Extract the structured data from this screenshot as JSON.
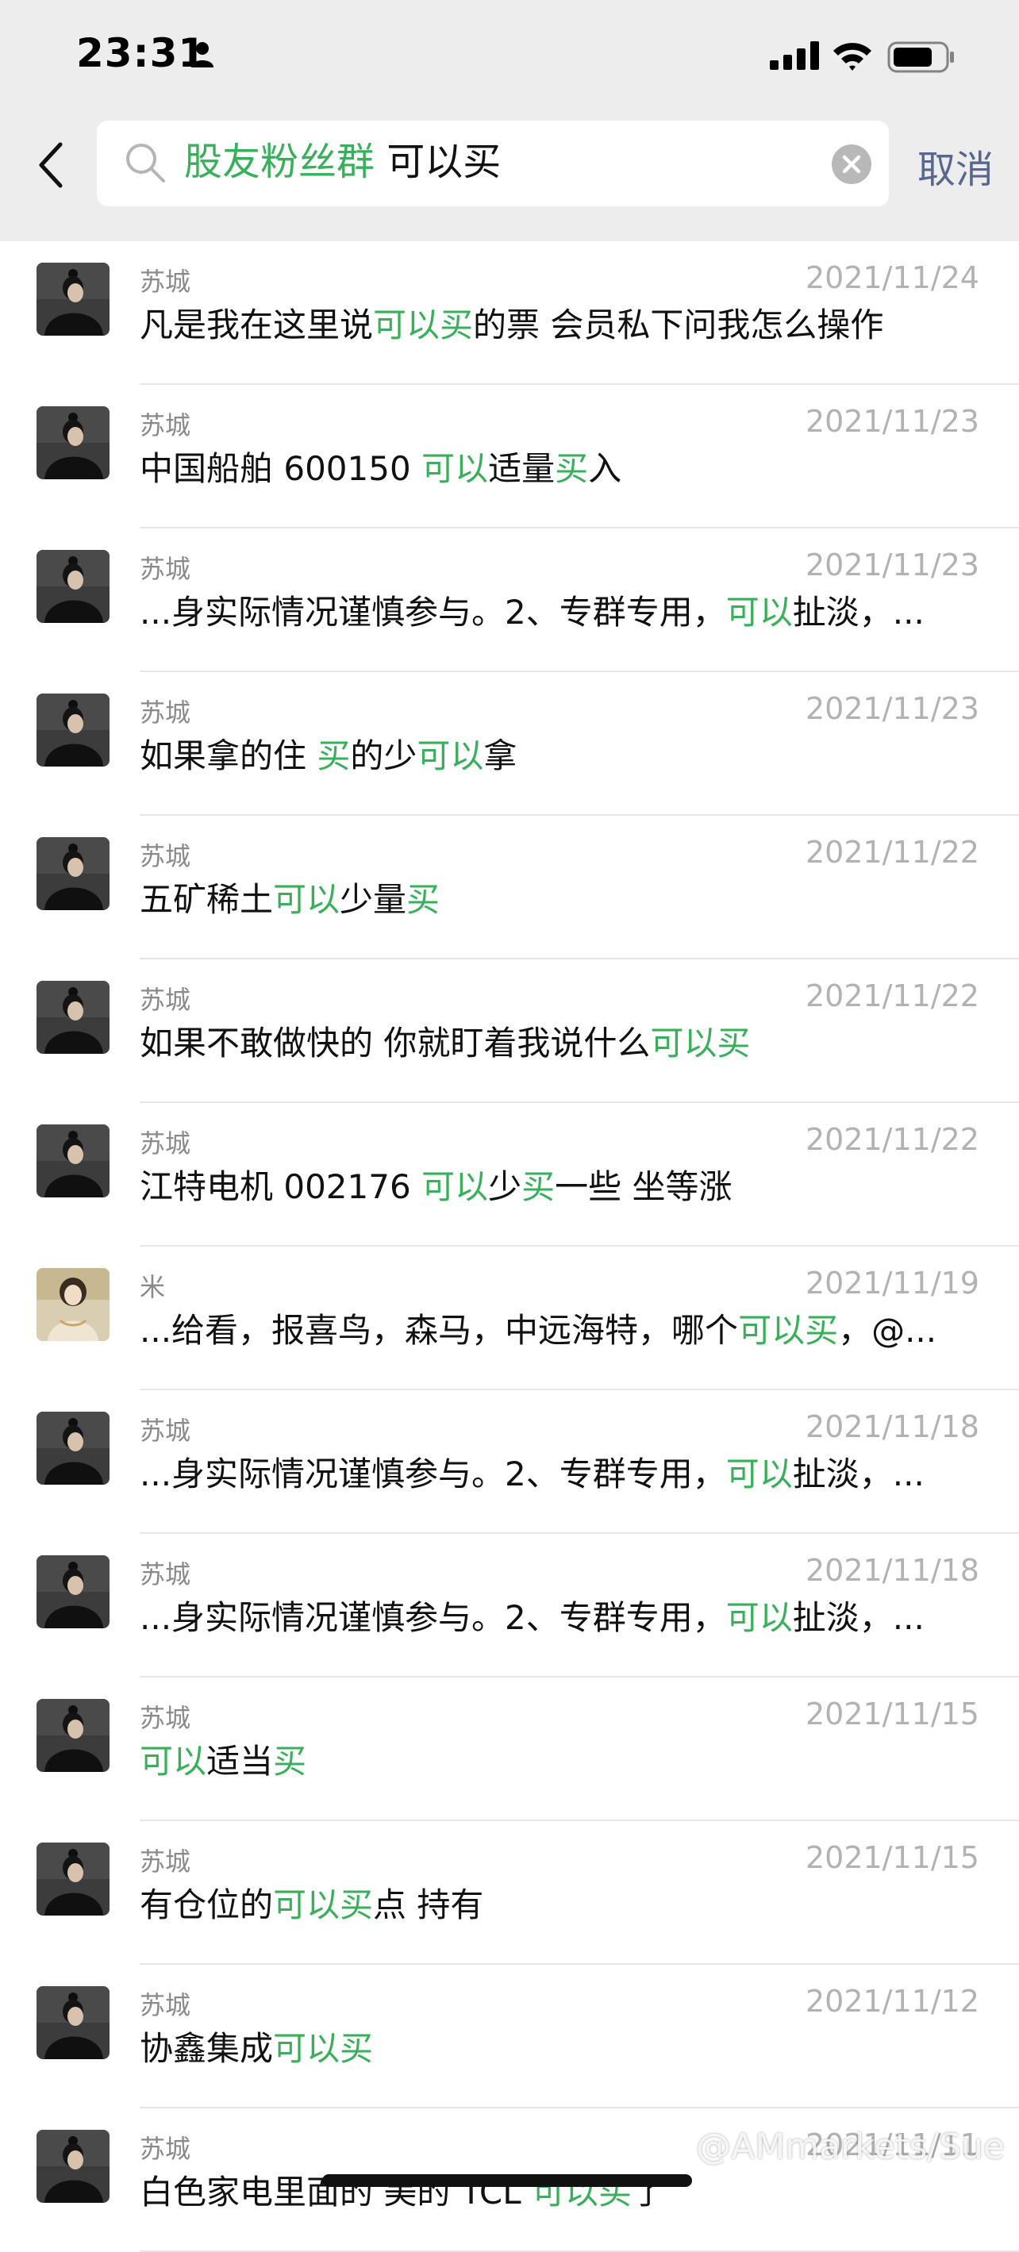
{
  "status_bar": {
    "time": "23:31"
  },
  "search": {
    "chat_tag": "股友粉丝群",
    "query": "可以买",
    "cancel_label": "取消"
  },
  "results": [
    {
      "name": "苏城",
      "date": "2021/11/24",
      "avatar": "man",
      "parts": [
        [
          "凡是我在这里说",
          false
        ],
        [
          "可以买",
          true
        ],
        [
          "的票  会员私下问我怎么操作",
          false
        ]
      ]
    },
    {
      "name": "苏城",
      "date": "2021/11/23",
      "avatar": "man",
      "parts": [
        [
          "中国船舶 600150 ",
          false
        ],
        [
          "可以",
          true
        ],
        [
          "适量",
          false
        ],
        [
          "买",
          true
        ],
        [
          "入",
          false
        ]
      ]
    },
    {
      "name": "苏城",
      "date": "2021/11/23",
      "avatar": "man",
      "parts": [
        [
          "...身实际情况谨慎参与。2、专群专用，",
          false
        ],
        [
          "可以",
          true
        ],
        [
          "扯淡，...",
          false
        ]
      ]
    },
    {
      "name": "苏城",
      "date": "2021/11/23",
      "avatar": "man",
      "parts": [
        [
          "如果拿的住 ",
          false
        ],
        [
          "买",
          true
        ],
        [
          "的少",
          false
        ],
        [
          "可以",
          true
        ],
        [
          "拿",
          false
        ]
      ]
    },
    {
      "name": "苏城",
      "date": "2021/11/22",
      "avatar": "man",
      "parts": [
        [
          "五矿稀土",
          false
        ],
        [
          "可以",
          true
        ],
        [
          "少量",
          false
        ],
        [
          "买",
          true
        ]
      ]
    },
    {
      "name": "苏城",
      "date": "2021/11/22",
      "avatar": "man",
      "parts": [
        [
          "如果不敢做快的 你就盯着我说什么",
          false
        ],
        [
          "可以买",
          true
        ]
      ]
    },
    {
      "name": "苏城",
      "date": "2021/11/22",
      "avatar": "man",
      "parts": [
        [
          "江特电机 002176  ",
          false
        ],
        [
          "可以",
          true
        ],
        [
          "少",
          false
        ],
        [
          "买",
          true
        ],
        [
          "一些 坐等涨",
          false
        ]
      ]
    },
    {
      "name": "米",
      "date": "2021/11/19",
      "avatar": "woman",
      "parts": [
        [
          "...给看，报喜鸟，森马，中远海特，哪个",
          false
        ],
        [
          "可以买",
          true
        ],
        [
          "，@...",
          false
        ]
      ]
    },
    {
      "name": "苏城",
      "date": "2021/11/18",
      "avatar": "man",
      "parts": [
        [
          "...身实际情况谨慎参与。2、专群专用，",
          false
        ],
        [
          "可以",
          true
        ],
        [
          "扯淡，...",
          false
        ]
      ]
    },
    {
      "name": "苏城",
      "date": "2021/11/18",
      "avatar": "man",
      "parts": [
        [
          "...身实际情况谨慎参与。2、专群专用，",
          false
        ],
        [
          "可以",
          true
        ],
        [
          "扯淡，...",
          false
        ]
      ]
    },
    {
      "name": "苏城",
      "date": "2021/11/15",
      "avatar": "man",
      "parts": [
        [
          "可以",
          true
        ],
        [
          "适当",
          false
        ],
        [
          "买",
          true
        ]
      ]
    },
    {
      "name": "苏城",
      "date": "2021/11/15",
      "avatar": "man",
      "parts": [
        [
          "有仓位的",
          false
        ],
        [
          "可以买",
          true
        ],
        [
          "点  持有",
          false
        ]
      ]
    },
    {
      "name": "苏城",
      "date": "2021/11/12",
      "avatar": "man",
      "parts": [
        [
          "协鑫集成",
          false
        ],
        [
          "可以买",
          true
        ]
      ]
    },
    {
      "name": "苏城",
      "date": "2021/11/11",
      "avatar": "man",
      "parts": [
        [
          "白色家电里面的  美的 TCL ",
          false
        ],
        [
          "可以买",
          true
        ],
        [
          "了",
          false
        ]
      ]
    }
  ],
  "watermark": "@AMmarkets/Sue",
  "colors": {
    "highlight": "#38b05a",
    "cancel": "#57678e",
    "top_bg": "#ededed"
  }
}
